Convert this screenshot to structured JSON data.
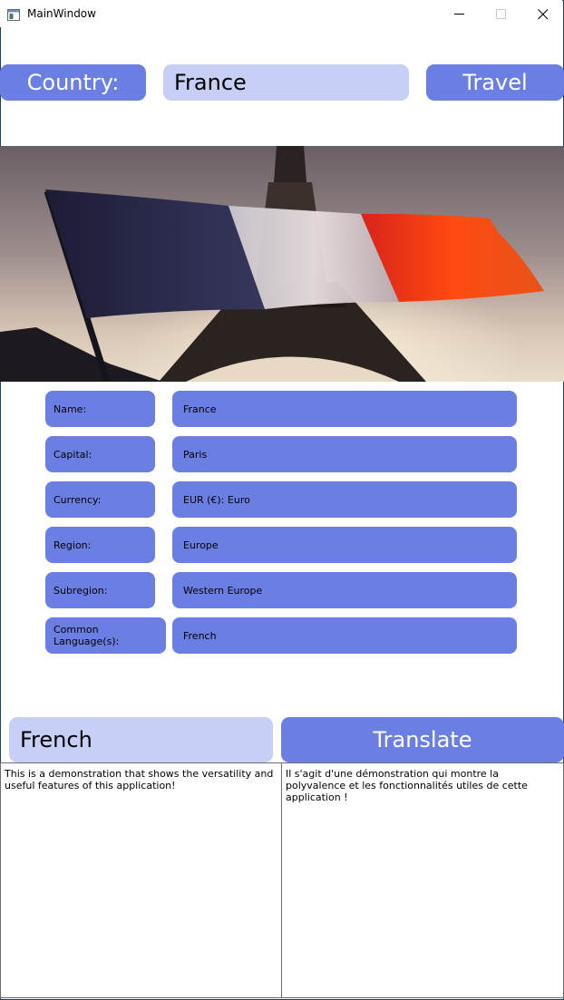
{
  "window": {
    "title": "MainWindow"
  },
  "country_row": {
    "label": "Country:",
    "country_value": "France",
    "travel_button": "Travel"
  },
  "info": {
    "rows": [
      {
        "label": "Name:",
        "value": "France"
      },
      {
        "label": "Capital:",
        "value": " Paris"
      },
      {
        "label": "Currency:",
        "value": " EUR (€): Euro"
      },
      {
        "label": "Region:",
        "value": "Europe"
      },
      {
        "label": "Subregion:",
        "value": "Western Europe"
      },
      {
        "label": "Common Language(s):",
        "value": "French"
      }
    ]
  },
  "translate_row": {
    "language_value": "French",
    "translate_button": "Translate"
  },
  "panes": {
    "source_text": "This is a demonstration that shows the versatility and useful features of this application!",
    "translated_text": "Il s'agit d'une démonstration qui montre la polyvalence et les fonctionnalités utiles de cette application !"
  },
  "colors": {
    "accent": "#6b7fe3",
    "field": "#c7cff7"
  }
}
